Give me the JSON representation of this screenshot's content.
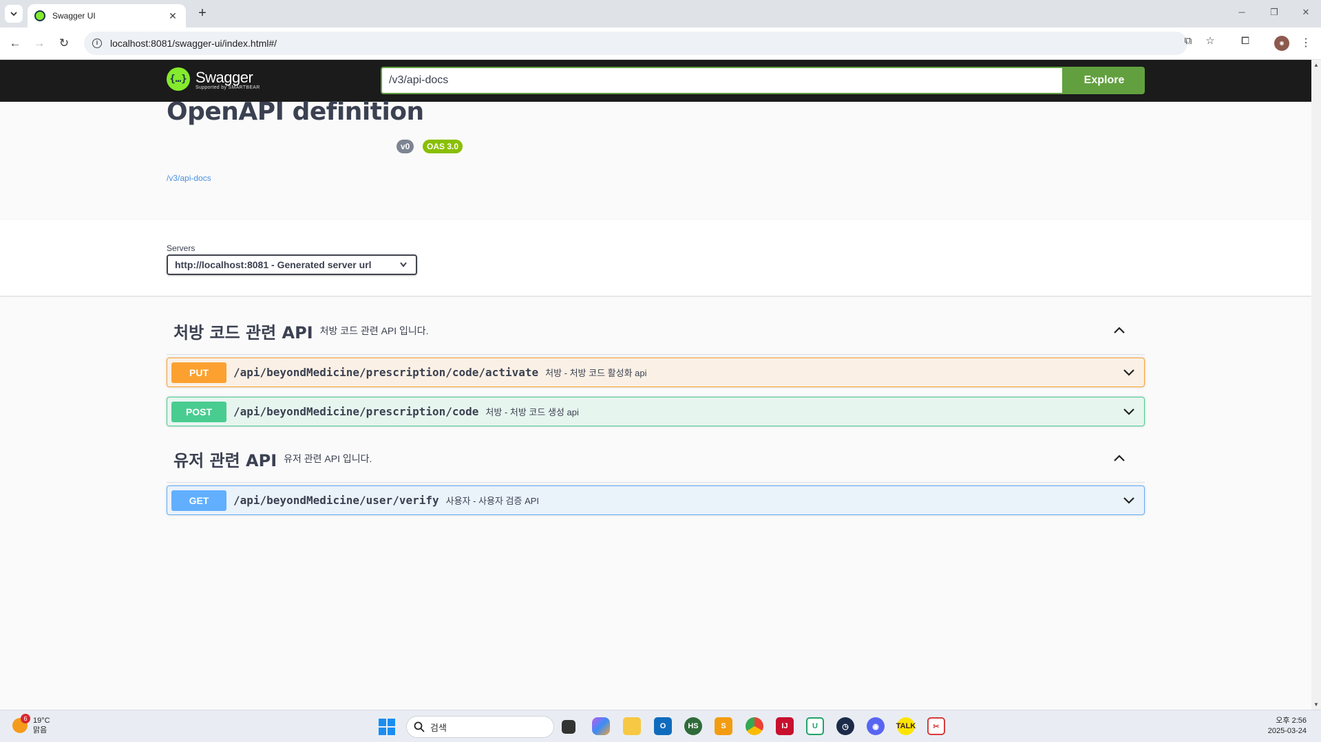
{
  "browser": {
    "tab_title": "Swagger UI",
    "url": "localhost:8081/swagger-ui/index.html#/"
  },
  "swagger": {
    "logo_name": "Swagger",
    "logo_sub": "Supported by SMARTBEAR",
    "search_value": "/v3/api-docs",
    "explore_label": "Explore",
    "title": "OpenAPI definition",
    "version_badge": "v0",
    "oas_badge": "OAS 3.0",
    "doc_link": "/v3/api-docs",
    "servers_label": "Servers",
    "server_selected": "http://localhost:8081 - Generated server url"
  },
  "tags": [
    {
      "name": "처방 코드 관련 API",
      "description": "처방 코드 관련 API 입니다.",
      "operations": [
        {
          "method": "PUT",
          "path": "/api/beyondMedicine/prescription/code/activate",
          "summary": "처방 - 처방 코드 활성화 api"
        },
        {
          "method": "POST",
          "path": "/api/beyondMedicine/prescription/code",
          "summary": "처방 - 처방 코드 생성 api"
        }
      ]
    },
    {
      "name": "유저 관련 API",
      "description": "유저 관련 API 입니다.",
      "operations": [
        {
          "method": "GET",
          "path": "/api/beyondMedicine/user/verify",
          "summary": "사용자 - 사용자 검증 API"
        }
      ]
    }
  ],
  "taskbar": {
    "weather_badge": "6",
    "weather_temp": "19°C",
    "weather_cond": "맑음",
    "search_placeholder": "검색",
    "clock_time": "오후 2:56",
    "clock_date": "2025-03-24"
  },
  "colors": {
    "put": "#fca130",
    "post": "#49cc90",
    "get": "#61affe",
    "explore": "#62a03f"
  }
}
